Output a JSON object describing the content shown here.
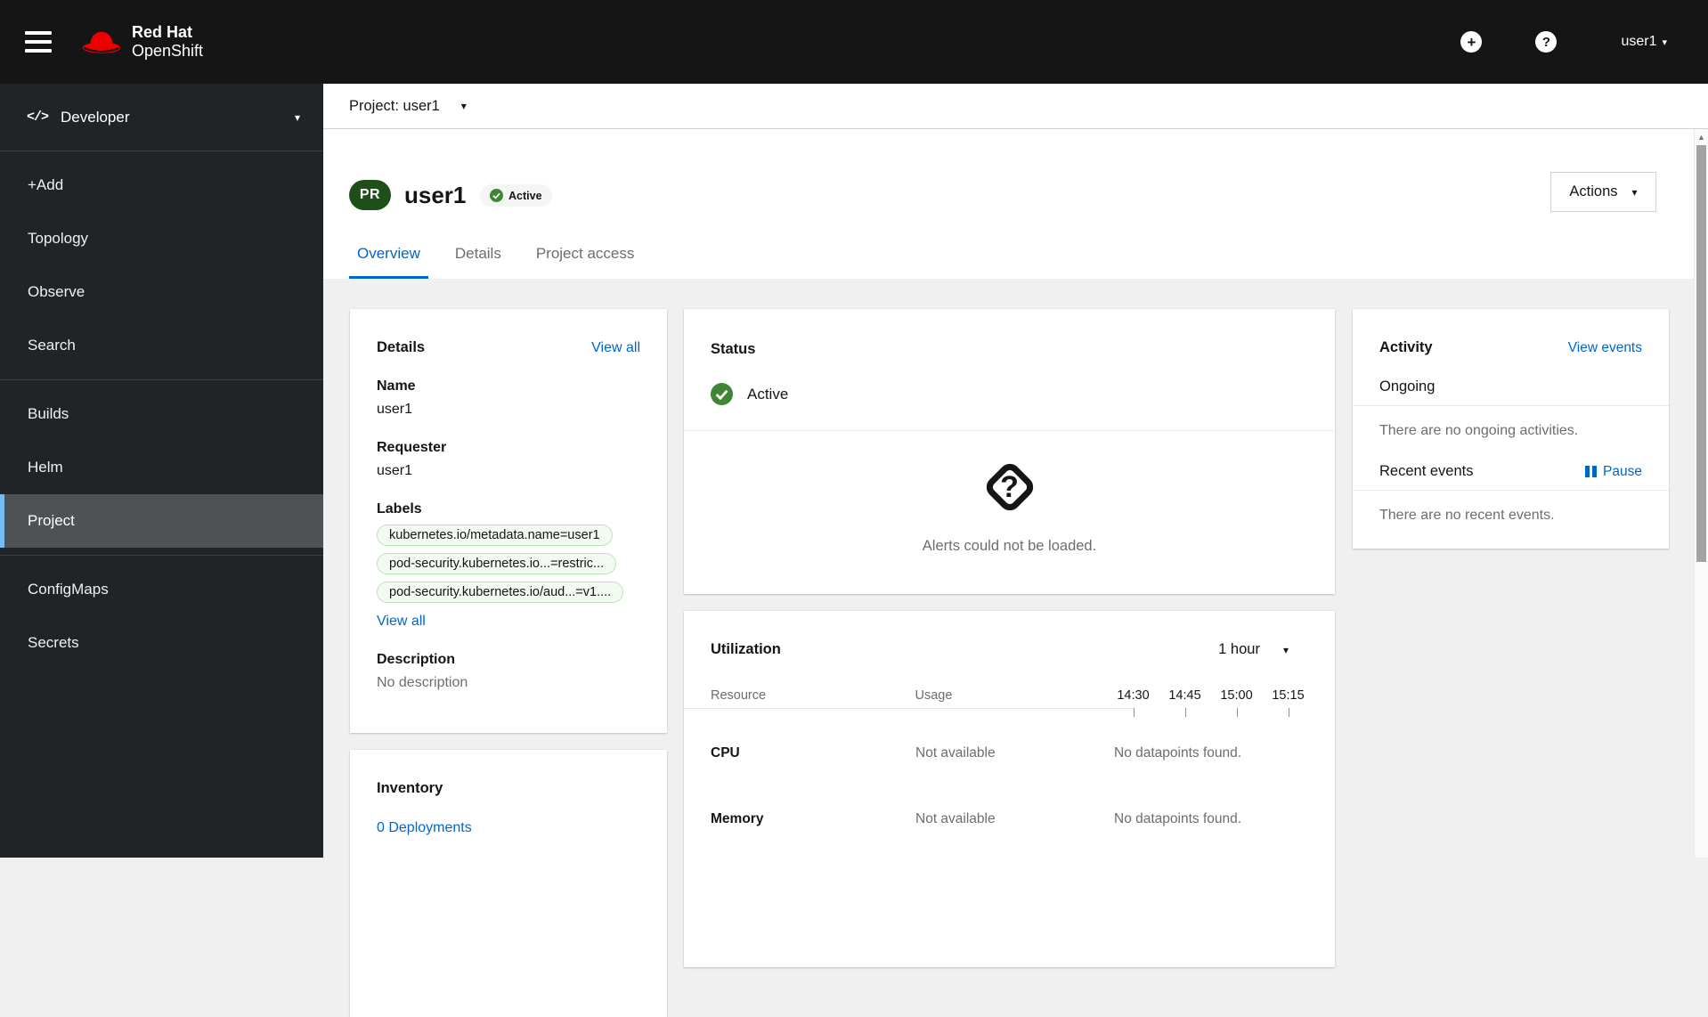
{
  "icons": {
    "caret_down": "▾",
    "caret_up": "▲",
    "plus": "+",
    "question_mark": "?",
    "code": "</>"
  },
  "colors": {
    "accent": "#0066cc",
    "status_green": "#3e8635",
    "project_badge_green": "#1e4f18",
    "label_bg": "#f3faf2",
    "label_border": "#bde5b8",
    "nav_selected_indicator": "#73bcf7",
    "masthead_bg": "#151515",
    "sidebar_bg": "#212427"
  },
  "masthead": {
    "brand_line1": "Red Hat",
    "brand_line2": "OpenShift",
    "user": "user1"
  },
  "sidebar": {
    "perspective": "Developer",
    "groups": [
      [
        "+Add",
        "Topology",
        "Observe",
        "Search"
      ],
      [
        "Builds",
        "Helm",
        "Project"
      ],
      [
        "ConfigMaps",
        "Secrets"
      ]
    ],
    "selected": "Project"
  },
  "project_bar": {
    "label": "Project: user1"
  },
  "page_header": {
    "badge": "PR",
    "title": "user1",
    "status": "Active",
    "actions_label": "Actions"
  },
  "tabs": {
    "items": [
      "Overview",
      "Details",
      "Project access"
    ],
    "active": "Overview"
  },
  "details_card": {
    "title": "Details",
    "view_all": "View all",
    "name_label": "Name",
    "name_value": "user1",
    "requester_label": "Requester",
    "requester_value": "user1",
    "labels_label": "Labels",
    "labels": [
      "kubernetes.io/metadata.name=user1",
      "pod-security.kubernetes.io...=restric...",
      "pod-security.kubernetes.io/aud...=v1...."
    ],
    "labels_view_all": "View all",
    "description_label": "Description",
    "description_value": "No description"
  },
  "status_card": {
    "title": "Status",
    "status_value": "Active",
    "alerts_message": "Alerts could not be loaded."
  },
  "utilization_card": {
    "title": "Utilization",
    "duration": "1 hour",
    "col_resource": "Resource",
    "col_usage": "Usage",
    "times": [
      "14:30",
      "14:45",
      "15:00",
      "15:15"
    ],
    "rows": [
      {
        "name": "CPU",
        "usage": "Not available",
        "datapoints": "No datapoints found."
      },
      {
        "name": "Memory",
        "usage": "Not available",
        "datapoints": "No datapoints found."
      }
    ]
  },
  "activity_card": {
    "title": "Activity",
    "view_events": "View events",
    "ongoing_title": "Ongoing",
    "no_ongoing": "There are no ongoing activities.",
    "recent_title": "Recent events",
    "pause_label": "Pause",
    "no_recent": "There are no recent events."
  },
  "inventory_card": {
    "title": "Inventory",
    "deployments_link": "0 Deployments"
  }
}
